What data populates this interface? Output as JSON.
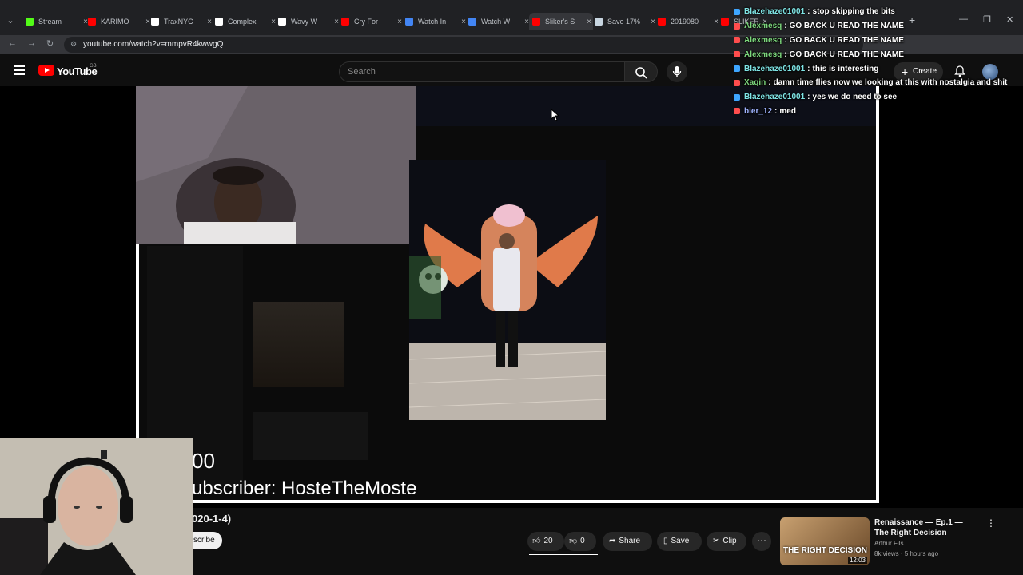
{
  "browser": {
    "tabs": [
      {
        "label": "Stream",
        "icon": "kick-icon",
        "color": "#53fc18"
      },
      {
        "label": "KARIMO",
        "icon": "youtube-icon",
        "color": "#ff0000"
      },
      {
        "label": "TraxNYC",
        "icon": "x-icon",
        "color": "#ffffff"
      },
      {
        "label": "Complex",
        "icon": "x-icon",
        "color": "#ffffff"
      },
      {
        "label": "Wavy W",
        "icon": "x-icon",
        "color": "#ffffff"
      },
      {
        "label": "Cry For",
        "icon": "youtube-icon",
        "color": "#ff0000"
      },
      {
        "label": "Watch In",
        "icon": "globe-icon",
        "color": "#4285f4"
      },
      {
        "label": "Watch W",
        "icon": "globe-icon",
        "color": "#4285f4"
      },
      {
        "label": "Sliker's S",
        "icon": "youtube-icon",
        "color": "#ff0000"
      },
      {
        "label": "Save 17%",
        "icon": "steam-icon",
        "color": "#c7d5e0"
      },
      {
        "label": "2019080",
        "icon": "youtube-icon",
        "color": "#ff0000"
      },
      {
        "label": "SLIKER",
        "icon": "youtube-icon",
        "color": "#ff0000"
      }
    ],
    "url": "youtube.com/watch?v=mmpvR4kwwgQ"
  },
  "youtube": {
    "logo_text": "YouTube",
    "region": "GB",
    "search_placeholder": "Search",
    "create_label": "Create"
  },
  "chat": [
    {
      "user": "Blazehaze01001",
      "color": "#7fe5e5",
      "badge": "#3ea6ff",
      "message": "stop skipping the bits"
    },
    {
      "user": "Alexmesq",
      "color": "#7dd87d",
      "badge": "#ff4d4d",
      "message": "GO BACK U READ THE NAME"
    },
    {
      "user": "Alexmesq",
      "color": "#7dd87d",
      "badge": "#ff4d4d",
      "message": "GO BACK U READ THE NAME"
    },
    {
      "user": "Alexmesq",
      "color": "#7dd87d",
      "badge": "#ff4d4d",
      "message": "GO BACK U READ THE NAME"
    },
    {
      "user": "Blazehaze01001",
      "color": "#7fe5e5",
      "badge": "#3ea6ff",
      "message": "this is interesting"
    },
    {
      "user": "Xaqin",
      "color": "#7dd87d",
      "badge": "#ff4d4d",
      "message": "damn time flies now we looking at this with nostalgia and shit"
    },
    {
      "user": "Blazehaze01001",
      "color": "#7fe5e5",
      "badge": "#3ea6ff",
      "message": "yes we do need to see"
    },
    {
      "user": "bier_12",
      "color": "#9fb3ff",
      "badge": "#ff4d4d",
      "message": "med"
    }
  ],
  "video_overlay": {
    "line1": "00",
    "line2": "ubscriber: HosteTheMoste"
  },
  "video_info": {
    "date_text": "020-1-4)",
    "subscribe_label": "scribe",
    "likes": "20",
    "dislikes": "0",
    "share_label": "Share",
    "save_label": "Save",
    "clip_label": "Clip"
  },
  "recommendation": {
    "title": "Renaissance — Ep.1 — The Right Decision",
    "channel": "Arthur Fils",
    "meta": "8k views · 5 hours ago",
    "thumb_text": "THE RIGHT DECISION",
    "duration": "12:03"
  }
}
